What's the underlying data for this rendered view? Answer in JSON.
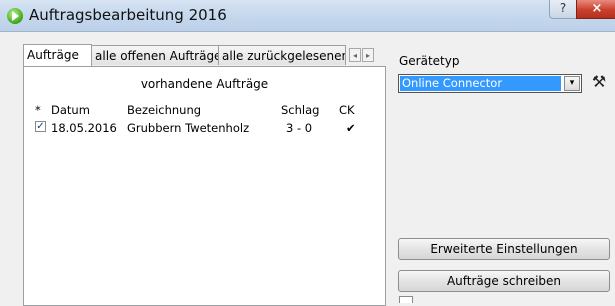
{
  "window": {
    "title": "Auftragsbearbeitung 2016",
    "help_label": "?",
    "close_label": "×"
  },
  "tabs": [
    {
      "label": "Aufträge"
    },
    {
      "label": "alle offenen Aufträge"
    },
    {
      "label": "alle zurückgelesenen Au"
    }
  ],
  "tab_scroll": {
    "left": "◂",
    "right": "▸"
  },
  "orders": {
    "section_title": "vorhandene Aufträge",
    "columns": [
      "*",
      "Datum",
      "Bezeichnung",
      "Schlag",
      "CK"
    ],
    "rows": [
      {
        "checked": "✓",
        "date": "18.05.2016",
        "name": "Grubbern Twetenholz",
        "schlag": "3 - 0",
        "ck": "✔"
      }
    ]
  },
  "device": {
    "label": "Gerätetyp",
    "selected": "Online Connector",
    "dropdown_glyph": "▾",
    "tool_icon_glyph": "⚒"
  },
  "buttons": {
    "advanced": "Erweiterte Einstellungen",
    "write": "Aufträge schreiben"
  }
}
